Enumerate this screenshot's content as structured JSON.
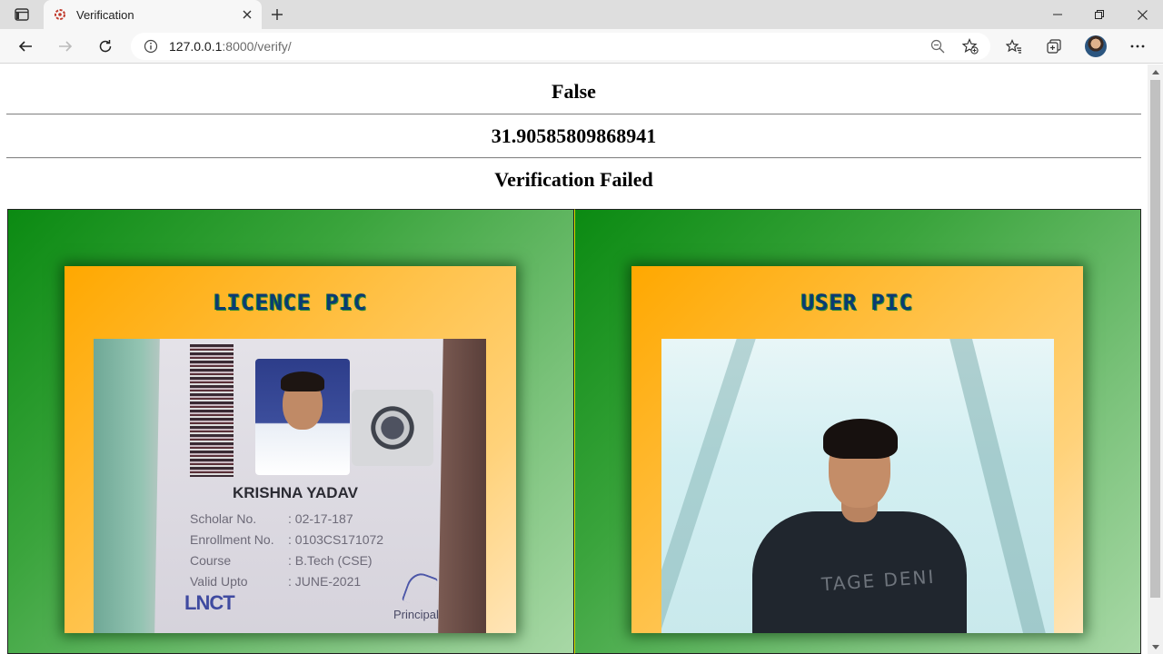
{
  "browser": {
    "tab_title": "Verification",
    "url_host": "127.0.0.1",
    "url_path": ":8000/verify/"
  },
  "result": {
    "match": "False",
    "distance": "31.90585809868941",
    "status": "Verification Failed"
  },
  "licence_panel": {
    "title": "LICENCE PIC",
    "card": {
      "name": "KRISHNA YADAV",
      "rows": [
        {
          "key": "Scholar No.",
          "value": ": 02-17-187"
        },
        {
          "key": "Enrollment No.",
          "value": ": 0103CS171072"
        },
        {
          "key": "Course",
          "value": ": B.Tech (CSE)"
        },
        {
          "key": "Valid Upto",
          "value": ": JUNE-2021"
        }
      ],
      "logo": "LNCT",
      "signatory": "Principal"
    }
  },
  "user_panel": {
    "title": "USER PIC",
    "shirt_text": "TAGE DENI"
  },
  "colors": {
    "panel_green": "#0b8a12",
    "card_orange": "#ffa800",
    "title_navy": "#0b3a73"
  }
}
